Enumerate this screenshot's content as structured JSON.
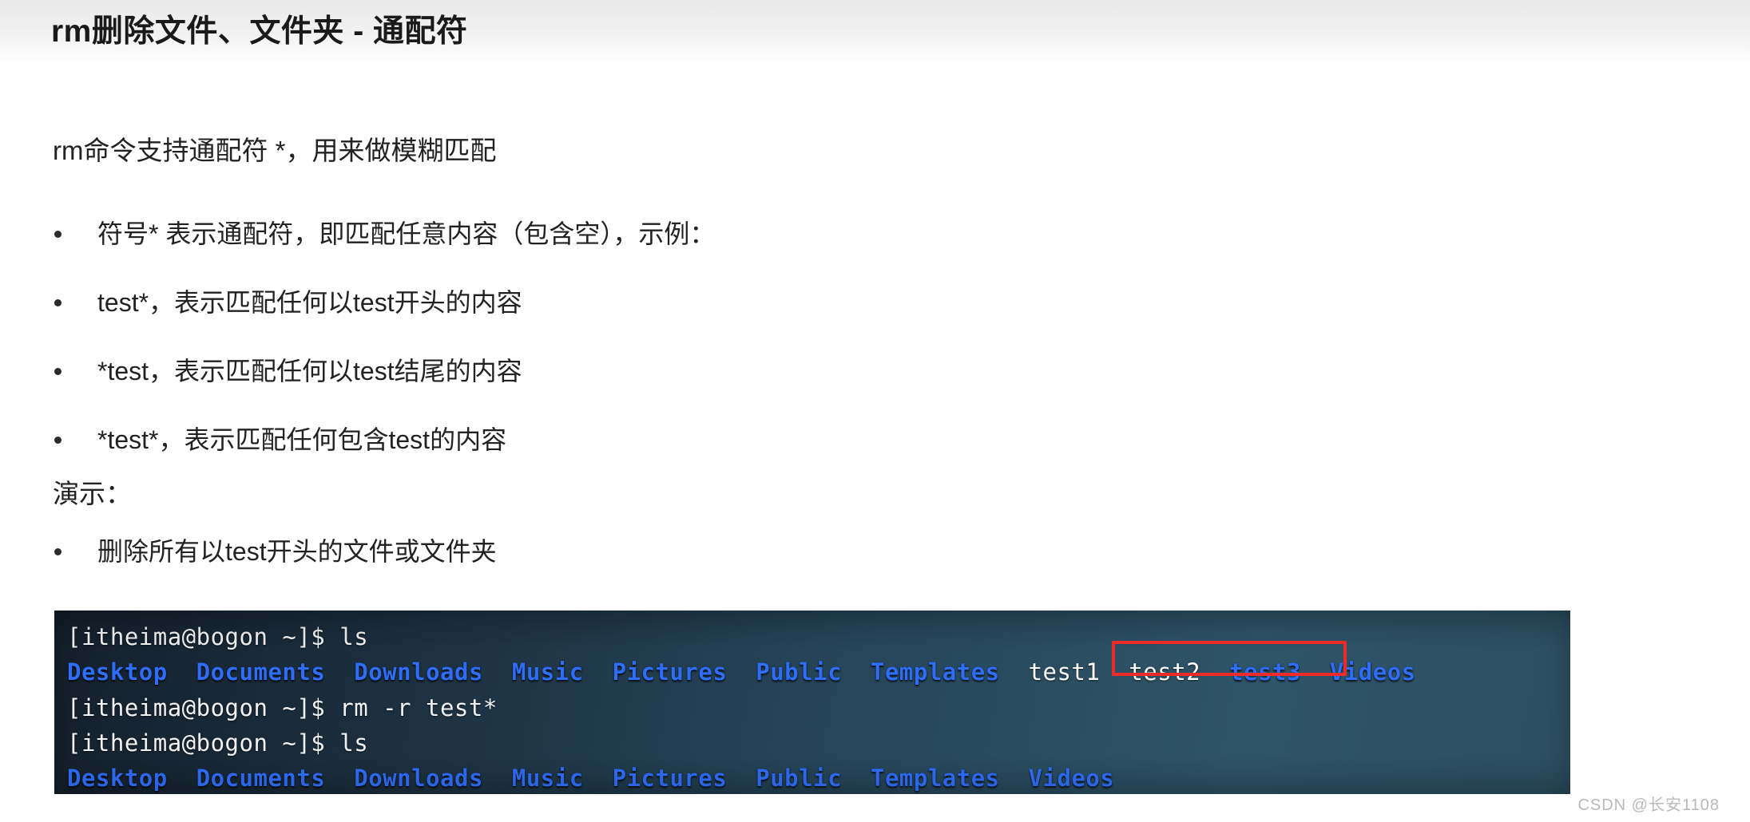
{
  "header": {
    "title": "rm删除文件、文件夹 - 通配符"
  },
  "content": {
    "lead": "rm命令支持通配符 *，用来做模糊匹配",
    "bullets": [
      {
        "text": "符号* 表示通配符，即匹配任意内容（包含空），示例："
      },
      {
        "text": "test*，表示匹配任何以test开头的内容"
      },
      {
        "text": "*test，表示匹配任何以test结尾的内容"
      },
      {
        "text": "*test*，表示匹配任何包含test的内容"
      }
    ],
    "section_label": "演示：",
    "demo_bullet": "删除所有以test开头的文件或文件夹"
  },
  "terminal": {
    "prompt": "[itheima@bogon ~]$",
    "lines": [
      {
        "type": "command",
        "prompt": "[itheima@bogon ~]$",
        "command": "ls"
      },
      {
        "type": "output",
        "entries": [
          {
            "name": "Desktop",
            "kind": "dir"
          },
          {
            "name": "Documents",
            "kind": "dir"
          },
          {
            "name": "Downloads",
            "kind": "dir"
          },
          {
            "name": "Music",
            "kind": "dir"
          },
          {
            "name": "Pictures",
            "kind": "dir"
          },
          {
            "name": "Public",
            "kind": "dir"
          },
          {
            "name": "Templates",
            "kind": "dir"
          },
          {
            "name": "test1",
            "kind": "file"
          },
          {
            "name": "test2",
            "kind": "file"
          },
          {
            "name": "test3",
            "kind": "dir"
          },
          {
            "name": "Videos",
            "kind": "dir"
          }
        ]
      },
      {
        "type": "command",
        "prompt": "[itheima@bogon ~]$",
        "command": "rm -r test*"
      },
      {
        "type": "command",
        "prompt": "[itheima@bogon ~]$",
        "command": "ls"
      },
      {
        "type": "output",
        "entries": [
          {
            "name": "Desktop",
            "kind": "dir"
          },
          {
            "name": "Documents",
            "kind": "dir"
          },
          {
            "name": "Downloads",
            "kind": "dir"
          },
          {
            "name": "Music",
            "kind": "dir"
          },
          {
            "name": "Pictures",
            "kind": "dir"
          },
          {
            "name": "Public",
            "kind": "dir"
          },
          {
            "name": "Templates",
            "kind": "dir"
          },
          {
            "name": "Videos",
            "kind": "dir"
          }
        ]
      }
    ],
    "highlight": {
      "label": "test1 test2 test3",
      "color": "#ee2b2b"
    }
  },
  "watermark": "CSDN @长安1108",
  "colors": {
    "directory": "#2f6df6",
    "file": "#ffffff",
    "prompt": "#f2f2f2",
    "highlight": "#ee2b2b",
    "terminal_bg": "#26465a"
  }
}
